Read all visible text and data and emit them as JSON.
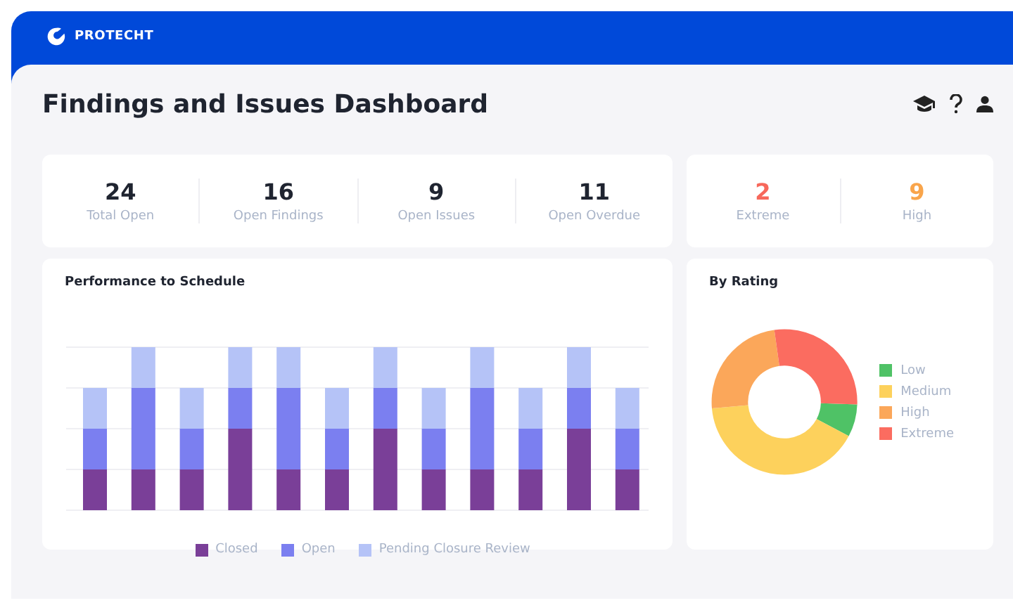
{
  "brand": {
    "name": "PROTECHT"
  },
  "page": {
    "title": "Findings and Issues Dashboard"
  },
  "stats": [
    {
      "value": "24",
      "label": "Total Open",
      "color": "#1f2430"
    },
    {
      "value": "16",
      "label": "Open Findings",
      "color": "#1f2430"
    },
    {
      "value": "9",
      "label": "Open Issues",
      "color": "#1f2430"
    },
    {
      "value": "11",
      "label": "Open Overdue",
      "color": "#1f2430"
    }
  ],
  "rating_stats": [
    {
      "value": "2",
      "label": "Extreme",
      "color": "#f7685b"
    },
    {
      "value": "9",
      "label": "High",
      "color": "#f9a54b"
    }
  ],
  "performance": {
    "title": "Performance to Schedule",
    "legend": [
      {
        "label": "Closed",
        "color": "#7a3f98"
      },
      {
        "label": "Open",
        "color": "#7b7ff0"
      },
      {
        "label": "Pending Closure Review",
        "color": "#b5c3f7"
      }
    ]
  },
  "by_rating": {
    "title": "By Rating",
    "legend": [
      {
        "label": "Low",
        "color": "#4fc266"
      },
      {
        "label": "Medium",
        "color": "#fdd15c"
      },
      {
        "label": "High",
        "color": "#fba75a"
      },
      {
        "label": "Extreme",
        "color": "#fb6c60"
      }
    ]
  }
}
